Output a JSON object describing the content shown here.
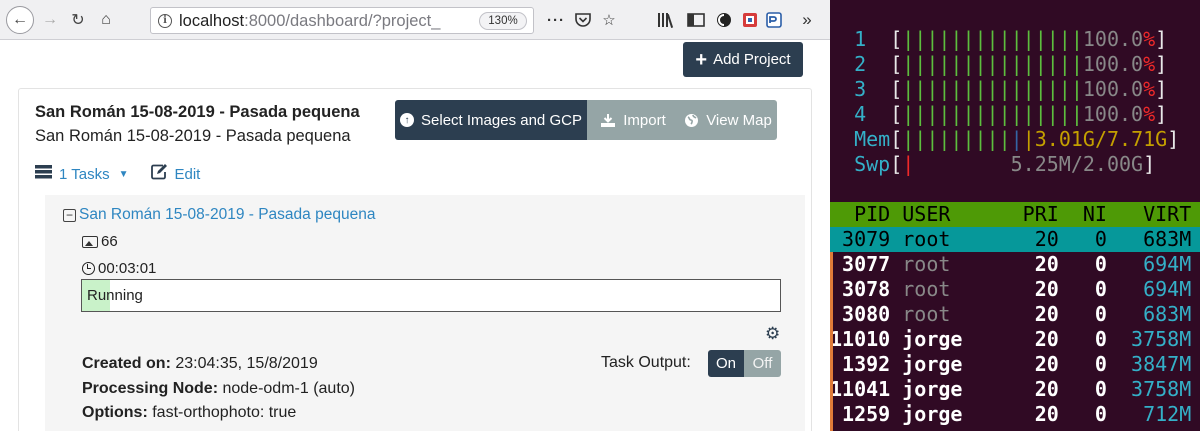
{
  "browser": {
    "url_host": "localhost",
    "url_rest": ":8000/dashboard/?project_",
    "zoom": "130%",
    "icons": [
      "back-arrow-icon",
      "forward-arrow-icon",
      "reload-icon",
      "home-icon",
      "info-icon",
      "more-dots-icon",
      "pocket-icon",
      "star-icon",
      "library-icon",
      "sidebar-icon",
      "extension-icon",
      "extension-icon",
      "overflow-icon"
    ]
  },
  "page": {
    "add_project_label": "Add Project",
    "project": {
      "title": "San Román 15-08-2019 - Pasada pequena",
      "description": "San Román 15-08-2019 - Pasada pequena",
      "buttons": {
        "select_images": "Select Images and GCP",
        "import": "Import",
        "view_map": "View Map"
      },
      "tasks_label": "1 Tasks",
      "edit_label": "Edit"
    },
    "task": {
      "name": "San Román 15-08-2019 - Pasada pequena",
      "image_count": "66",
      "elapsed": "00:03:01",
      "status": "Running",
      "progress": 0.04,
      "created_label": "Created on:",
      "created_value": "23:04:35, 15/8/2019",
      "node_label": "Processing Node:",
      "node_value": "node-odm-1 (auto)",
      "options_label": "Options:",
      "options_value": "fast-orthophoto: true",
      "output_label": "Task Output:",
      "output_on": "On",
      "output_off": "Off"
    }
  },
  "htop": {
    "cpus": [
      {
        "id": "1",
        "pct": "100.0%"
      },
      {
        "id": "2",
        "pct": "100.0%"
      },
      {
        "id": "3",
        "pct": "100.0%"
      },
      {
        "id": "4",
        "pct": "100.0%"
      }
    ],
    "mem": {
      "label": "Mem",
      "value": "3.01G/7.71G"
    },
    "swp": {
      "label": "Swp",
      "value": "5.25M/2.00G"
    },
    "columns": [
      "PID",
      "USER",
      "PRI",
      "NI",
      "VIRT"
    ],
    "processes": [
      {
        "pid": "3079",
        "user": "root",
        "pri": "20",
        "ni": "0",
        "virt": "683M"
      },
      {
        "pid": "3077",
        "user": "root",
        "pri": "20",
        "ni": "0",
        "virt": "694M"
      },
      {
        "pid": "3078",
        "user": "root",
        "pri": "20",
        "ni": "0",
        "virt": "694M"
      },
      {
        "pid": "3080",
        "user": "root",
        "pri": "20",
        "ni": "0",
        "virt": "683M"
      },
      {
        "pid": "11010",
        "user": "jorge",
        "pri": "20",
        "ni": "0",
        "virt": "3758M"
      },
      {
        "pid": "1392",
        "user": "jorge",
        "pri": "20",
        "ni": "0",
        "virt": "3847M"
      },
      {
        "pid": "11041",
        "user": "jorge",
        "pri": "20",
        "ni": "0",
        "virt": "3758M"
      },
      {
        "pid": "1259",
        "user": "jorge",
        "pri": "20",
        "ni": "0",
        "virt": "712M"
      }
    ]
  }
}
